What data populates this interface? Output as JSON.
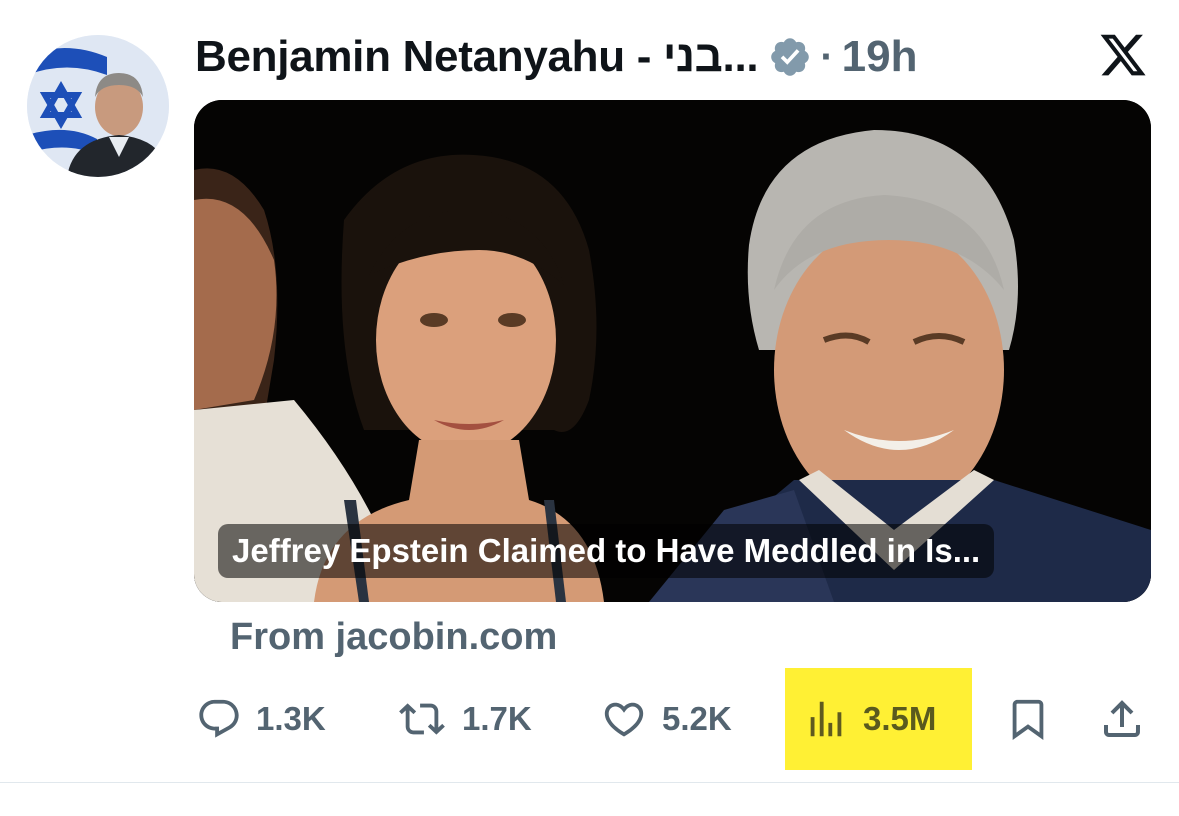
{
  "tweet": {
    "author_name": "Benjamin Netanyahu - בני...",
    "verified_icon": "verified-badge-icon",
    "separator": "·",
    "time": "19h"
  },
  "brand": {
    "logo": "x-logo-icon"
  },
  "card": {
    "title": "Jeffrey Epstein Claimed to Have Meddled in Is...",
    "source": "From jacobin.com"
  },
  "actions": {
    "replies": "1.3K",
    "reposts": "1.7K",
    "likes": "5.2K",
    "views": "3.5M",
    "highlight_color": "#fff034"
  },
  "colors": {
    "text_primary": "#0f1419",
    "text_secondary": "#536471",
    "verified": "#829aab"
  }
}
